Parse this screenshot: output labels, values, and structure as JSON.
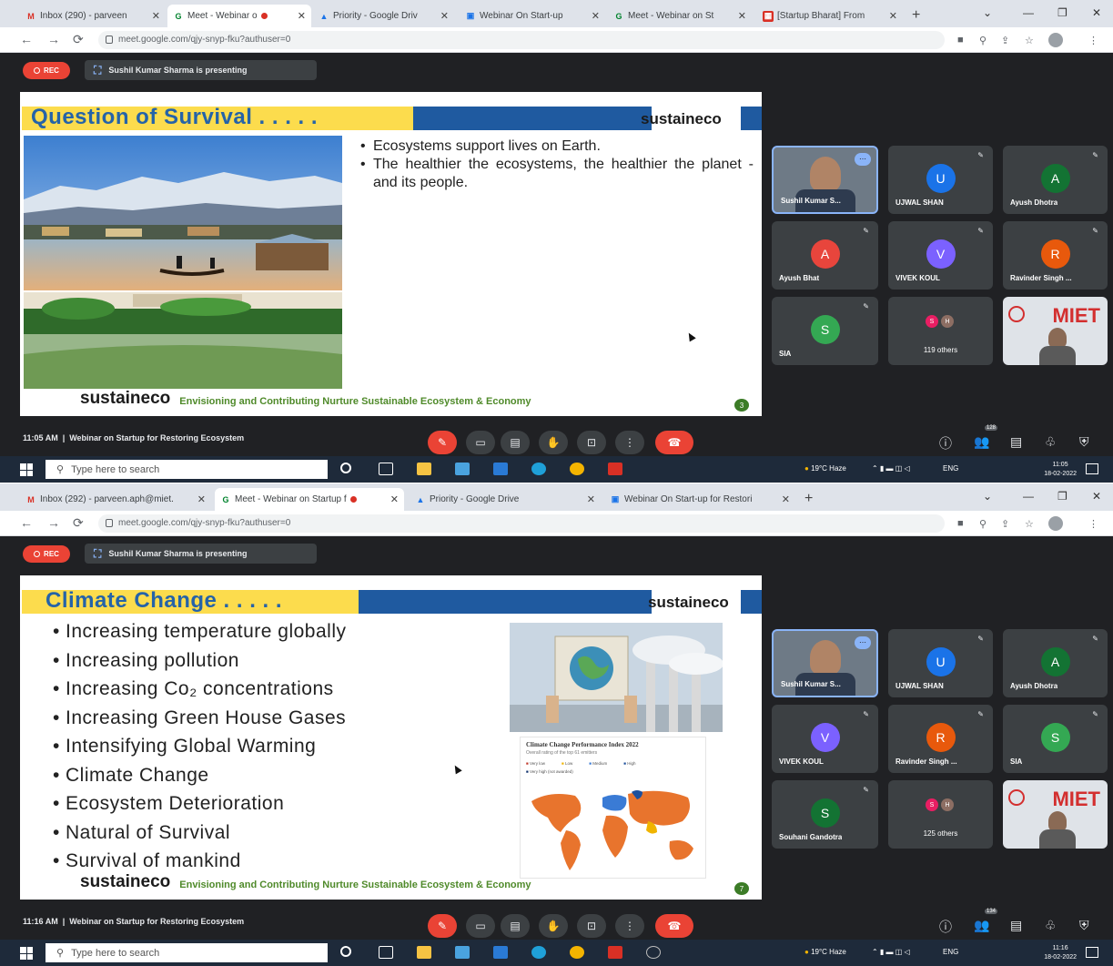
{
  "screenshots": [
    {
      "tabs": [
        {
          "label": "Inbox (290) - parveen",
          "favicon": "M"
        },
        {
          "label": "Meet - Webinar o",
          "favicon": "G",
          "active": true,
          "recording": true
        },
        {
          "label": "Priority - Google Driv",
          "favicon": "▲"
        },
        {
          "label": "Webinar On Start-up",
          "favicon": "▣"
        },
        {
          "label": "Meet - Webinar on St",
          "favicon": "G"
        },
        {
          "label": "[Startup Bharat] From",
          "favicon": "▦"
        }
      ],
      "url": "meet.google.com/qjy-snyp-fku?authuser=0",
      "rec_label": "REC",
      "presenting": "Sushil Kumar Sharma is presenting",
      "slide": {
        "title": "Question of Survival . . . . .",
        "logo": "sustaineco",
        "bullets": [
          "Ecosystems support lives on Earth.",
          "The healthier the ecosystems, the healthier the planet - and its people."
        ],
        "footer_logo": "sustaineco",
        "footer_tagline": "Envisioning and Contributing Nurture Sustainable Ecosystem & Economy",
        "page": "3"
      },
      "participants": [
        {
          "name": "Sushil Kumar S...",
          "type": "video"
        },
        {
          "name": "UJWAL SHAN",
          "initial": "U",
          "color": "#1a73e8"
        },
        {
          "name": "Ayush Dhotra",
          "initial": "A",
          "color": "#137333"
        },
        {
          "name": "Ayush Bhat",
          "initial": "A",
          "color": "#e8453c"
        },
        {
          "name": "VIVEK KOUL",
          "initial": "V",
          "color": "#7b61ff"
        },
        {
          "name": "Ravinder Singh ...",
          "initial": "R",
          "color": "#e8590c"
        },
        {
          "name": "SIA",
          "initial": "S",
          "color": "#34a853"
        },
        {
          "name": "119 others",
          "type": "others",
          "mini": [
            "S",
            "H"
          ]
        },
        {
          "name": "MIET",
          "type": "video-miet"
        }
      ],
      "time": "11:05 AM",
      "meeting_title": "Webinar on Startup for Restoring Ecosystem",
      "people_badge": "128",
      "taskbar": {
        "search_placeholder": "Type here to search",
        "weather": "19°C Haze",
        "lang": "ENG",
        "clock_time": "11:05",
        "clock_date": "18-02-2022"
      }
    },
    {
      "tabs": [
        {
          "label": "Inbox (292) - parveen.aph@miet.",
          "favicon": "M"
        },
        {
          "label": "Meet - Webinar on Startup f",
          "favicon": "G",
          "active": true,
          "recording": true
        },
        {
          "label": "Priority - Google Drive",
          "favicon": "▲"
        },
        {
          "label": "Webinar On Start-up for Restori",
          "favicon": "▣"
        }
      ],
      "url": "meet.google.com/qjy-snyp-fku?authuser=0",
      "rec_label": "REC",
      "presenting": "Sushil Kumar Sharma is presenting",
      "slide": {
        "title": "Climate Change . . . . .",
        "logo": "sustaineco",
        "bullets": [
          "Increasing temperature globally",
          "Increasing pollution",
          "Increasing Co₂ concentrations",
          "Increasing Green House Gases",
          "Intensifying Global Warming",
          "Climate Change",
          "Ecosystem Deterioration",
          "Natural of Survival",
          "Survival of mankind"
        ],
        "map_title": "Climate Change Performance Index 2022",
        "map_subtitle": "Overall rating of the top 61 emitters",
        "legend": [
          "Very low",
          "Low",
          "Medium",
          "High",
          "Very high (not awarded)"
        ],
        "footer_logo": "sustaineco",
        "footer_tagline": "Envisioning and Contributing Nurture Sustainable Ecosystem & Economy",
        "page": "7"
      },
      "participants": [
        {
          "name": "Sushil Kumar S...",
          "type": "video"
        },
        {
          "name": "UJWAL SHAN",
          "initial": "U",
          "color": "#1a73e8"
        },
        {
          "name": "Ayush Dhotra",
          "initial": "A",
          "color": "#137333"
        },
        {
          "name": "VIVEK KOUL",
          "initial": "V",
          "color": "#7b61ff"
        },
        {
          "name": "Ravinder Singh ...",
          "initial": "R",
          "color": "#e8590c"
        },
        {
          "name": "SIA",
          "initial": "S",
          "color": "#34a853"
        },
        {
          "name": "Souhani Gandotra",
          "initial": "S",
          "color": "#137333"
        },
        {
          "name": "125 others",
          "type": "others",
          "mini": [
            "S",
            "H"
          ]
        },
        {
          "name": "MIET",
          "type": "video-miet"
        }
      ],
      "time": "11:16 AM",
      "meeting_title": "Webinar on Startup for Restoring Ecosystem",
      "people_badge": "134",
      "taskbar": {
        "search_placeholder": "Type here to search",
        "weather": "19°C Haze",
        "lang": "ENG",
        "clock_time": "11:16",
        "clock_date": "18-02-2022"
      }
    }
  ],
  "colors": {
    "meet_bg": "#202124",
    "tile_bg": "#3c4043",
    "end_call": "#ea4335",
    "slide_blue": "#1f5aa0",
    "slide_yellow": "#fcdc4d",
    "tagline_green": "#4f8a2a"
  }
}
